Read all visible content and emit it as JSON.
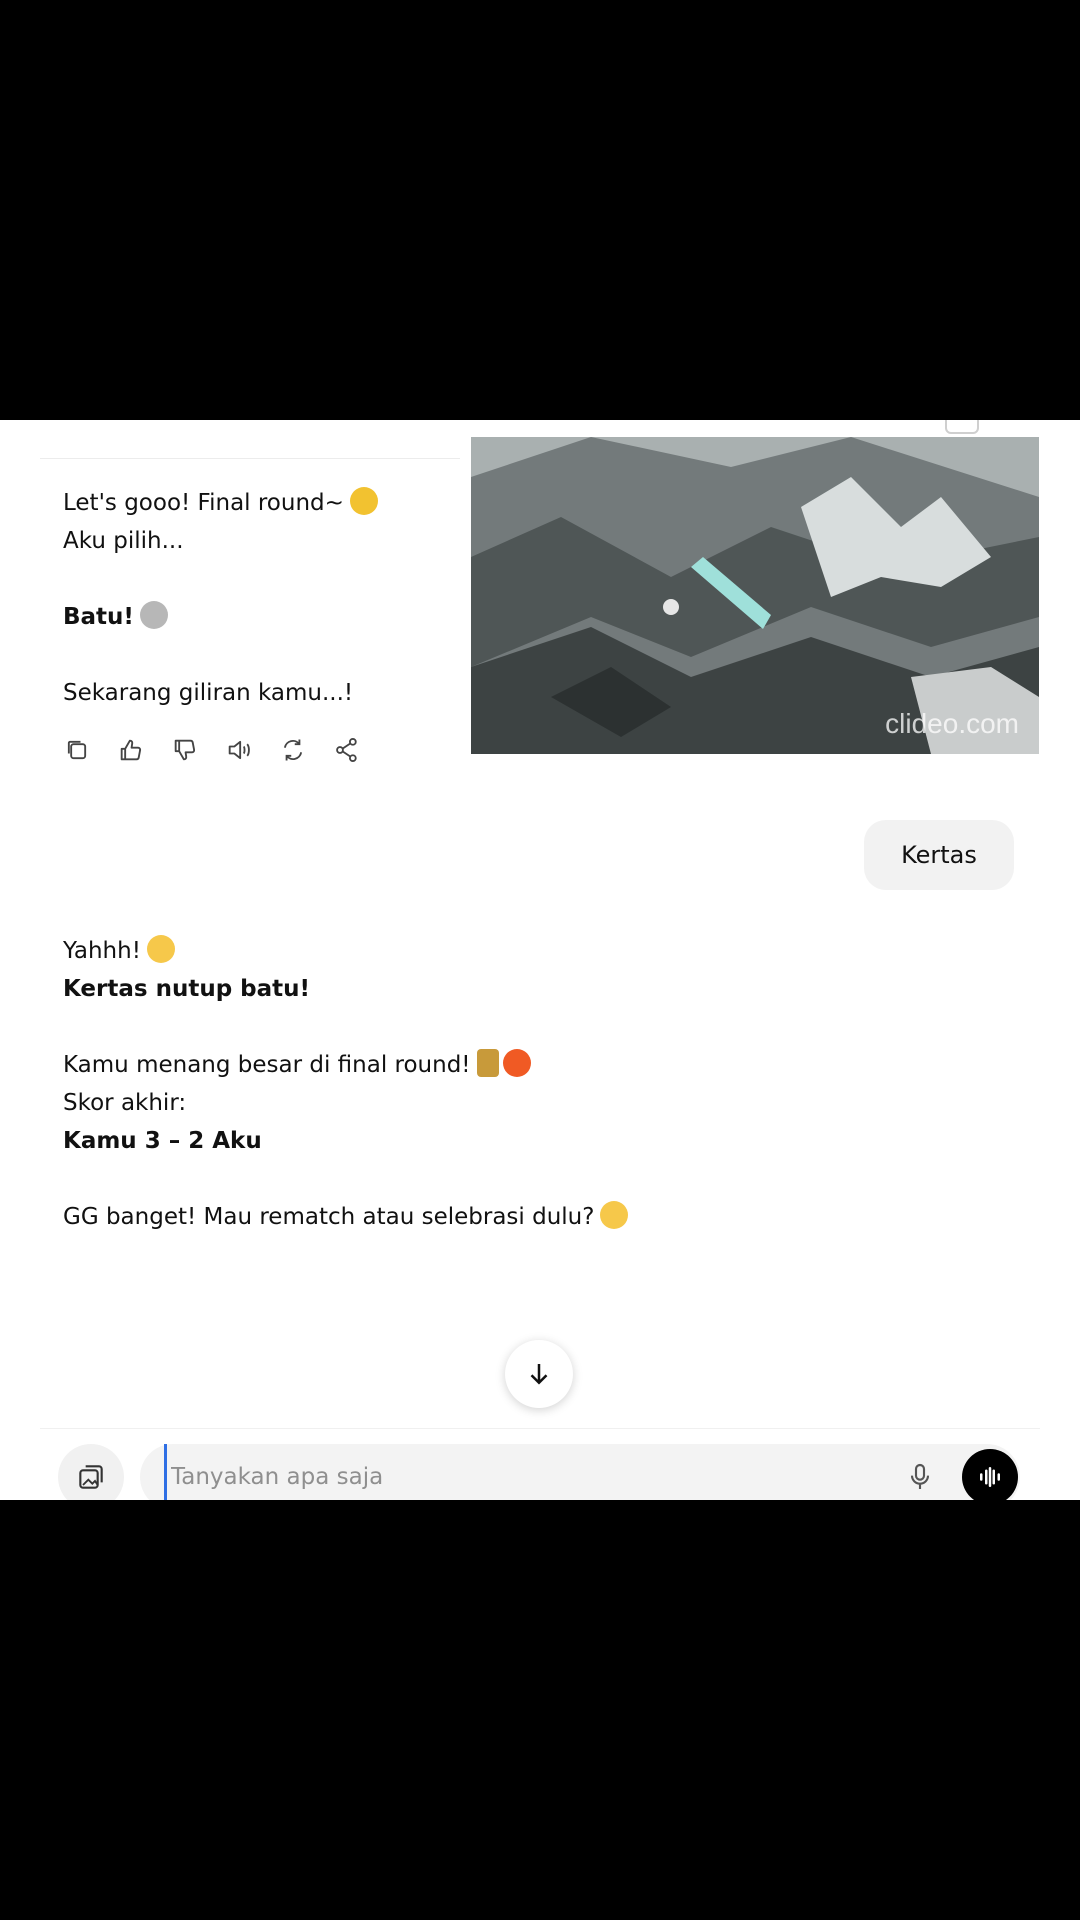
{
  "messages": {
    "ai1": {
      "line1": "Let's gooo! Final round~",
      "line2": "Aku pilih...",
      "line3": "Batu!",
      "line4": "Sekarang giliran kamu...!"
    },
    "user": {
      "text": "Kertas"
    },
    "ai2": {
      "line1": "Yahhh!",
      "line2": "Kertas nutup batu!",
      "line3": "Kamu menang besar di final round!",
      "line4": "Skor akhir:",
      "line5": "Kamu 3 – 2 Aku",
      "line6": "GG banget! Mau rematch atau selebrasi dulu?"
    }
  },
  "video": {
    "watermark": "clideo.com"
  },
  "composer": {
    "placeholder": "Tanyakan apa saja"
  },
  "icons": {
    "actions": [
      "copy-icon",
      "thumbs-up-icon",
      "thumbs-down-icon",
      "speaker-icon",
      "regenerate-icon",
      "share-icon"
    ],
    "emoji": [
      "bell-emoji",
      "rock-emoji",
      "crying-emoji",
      "trophy-emoji",
      "fire-emoji",
      "sunglasses-emoji"
    ]
  },
  "colors": {
    "accent": "#2f6fe4",
    "bubble": "#f2f2f2",
    "voice_button": "#000000"
  }
}
